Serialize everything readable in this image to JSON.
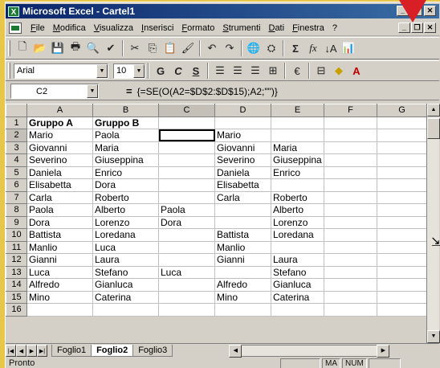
{
  "window": {
    "title": "Microsoft Excel - Cartel1",
    "app_icon": "excel-icon"
  },
  "menu": [
    "File",
    "Modifica",
    "Visualizza",
    "Inserisci",
    "Formato",
    "Strumenti",
    "Dati",
    "Finestra",
    "?"
  ],
  "toolbar_standard": {
    "buttons": [
      "new-icon",
      "open-icon",
      "save-icon",
      "print-icon",
      "print-preview-icon",
      "spelling-icon",
      "cut-icon",
      "copy-icon",
      "paste-icon",
      "format-painter-icon",
      "undo-icon",
      "redo-icon",
      "hyperlink-icon",
      "web-toolbar-icon",
      "autosum-icon",
      "function-icon",
      "sort-ascending-icon",
      "chart-wizard-icon"
    ],
    "autosum_glyph": "Σ",
    "function_glyph": "fx"
  },
  "toolbar_format": {
    "font": "Arial",
    "size": "10",
    "bold": "G",
    "italic": "C",
    "underline": "S"
  },
  "formula_bar": {
    "name_box": "C2",
    "equals": "=",
    "formula": "{=SE(O(A2=$D$2:$D$15);A2;\"\")}"
  },
  "columns": [
    "A",
    "B",
    "C",
    "D",
    "E",
    "F",
    "G"
  ],
  "rows": [
    [
      "Gruppo A",
      "Gruppo B",
      "",
      "",
      "",
      "",
      ""
    ],
    [
      "Mario",
      "Paola",
      "",
      "Mario",
      "",
      "",
      ""
    ],
    [
      "Giovanni",
      "Maria",
      "",
      "Giovanni",
      "Maria",
      "",
      ""
    ],
    [
      "Severino",
      "Giuseppina",
      "",
      "Severino",
      "Giuseppina",
      "",
      ""
    ],
    [
      "Daniela",
      "Enrico",
      "",
      "Daniela",
      "Enrico",
      "",
      ""
    ],
    [
      "Elisabetta",
      "Dora",
      "",
      "Elisabetta",
      "",
      "",
      ""
    ],
    [
      "Carla",
      "Roberto",
      "",
      "Carla",
      "Roberto",
      "",
      ""
    ],
    [
      "Paola",
      "Alberto",
      "Paola",
      "",
      "Alberto",
      "",
      ""
    ],
    [
      "Dora",
      "Lorenzo",
      "Dora",
      "",
      "Lorenzo",
      "",
      ""
    ],
    [
      "Battista",
      "Loredana",
      "",
      "Battista",
      "Loredana",
      "",
      ""
    ],
    [
      "Manlio",
      "Luca",
      "",
      "Manlio",
      "",
      "",
      ""
    ],
    [
      "Gianni",
      "Laura",
      "",
      "Gianni",
      "Laura",
      "",
      ""
    ],
    [
      "Luca",
      "Stefano",
      "Luca",
      "",
      "Stefano",
      "",
      ""
    ],
    [
      "Alfredo",
      "Gianluca",
      "",
      "Alfredo",
      "Gianluca",
      "",
      ""
    ],
    [
      "Mino",
      "Caterina",
      "",
      "Mino",
      "Caterina",
      "",
      ""
    ],
    [
      "",
      "",
      "",
      "",
      "",
      "",
      ""
    ]
  ],
  "active_cell": "C2",
  "sheet_tabs": [
    "Foglio1",
    "Foglio2",
    "Foglio3"
  ],
  "active_sheet": "Foglio2",
  "status": {
    "text": "Pronto",
    "indicators": [
      "MA",
      "NUM"
    ]
  },
  "colors": {
    "title_bar": "#0a246a",
    "background": "#e8c64a",
    "annotation_arrow": "#d81f26"
  }
}
